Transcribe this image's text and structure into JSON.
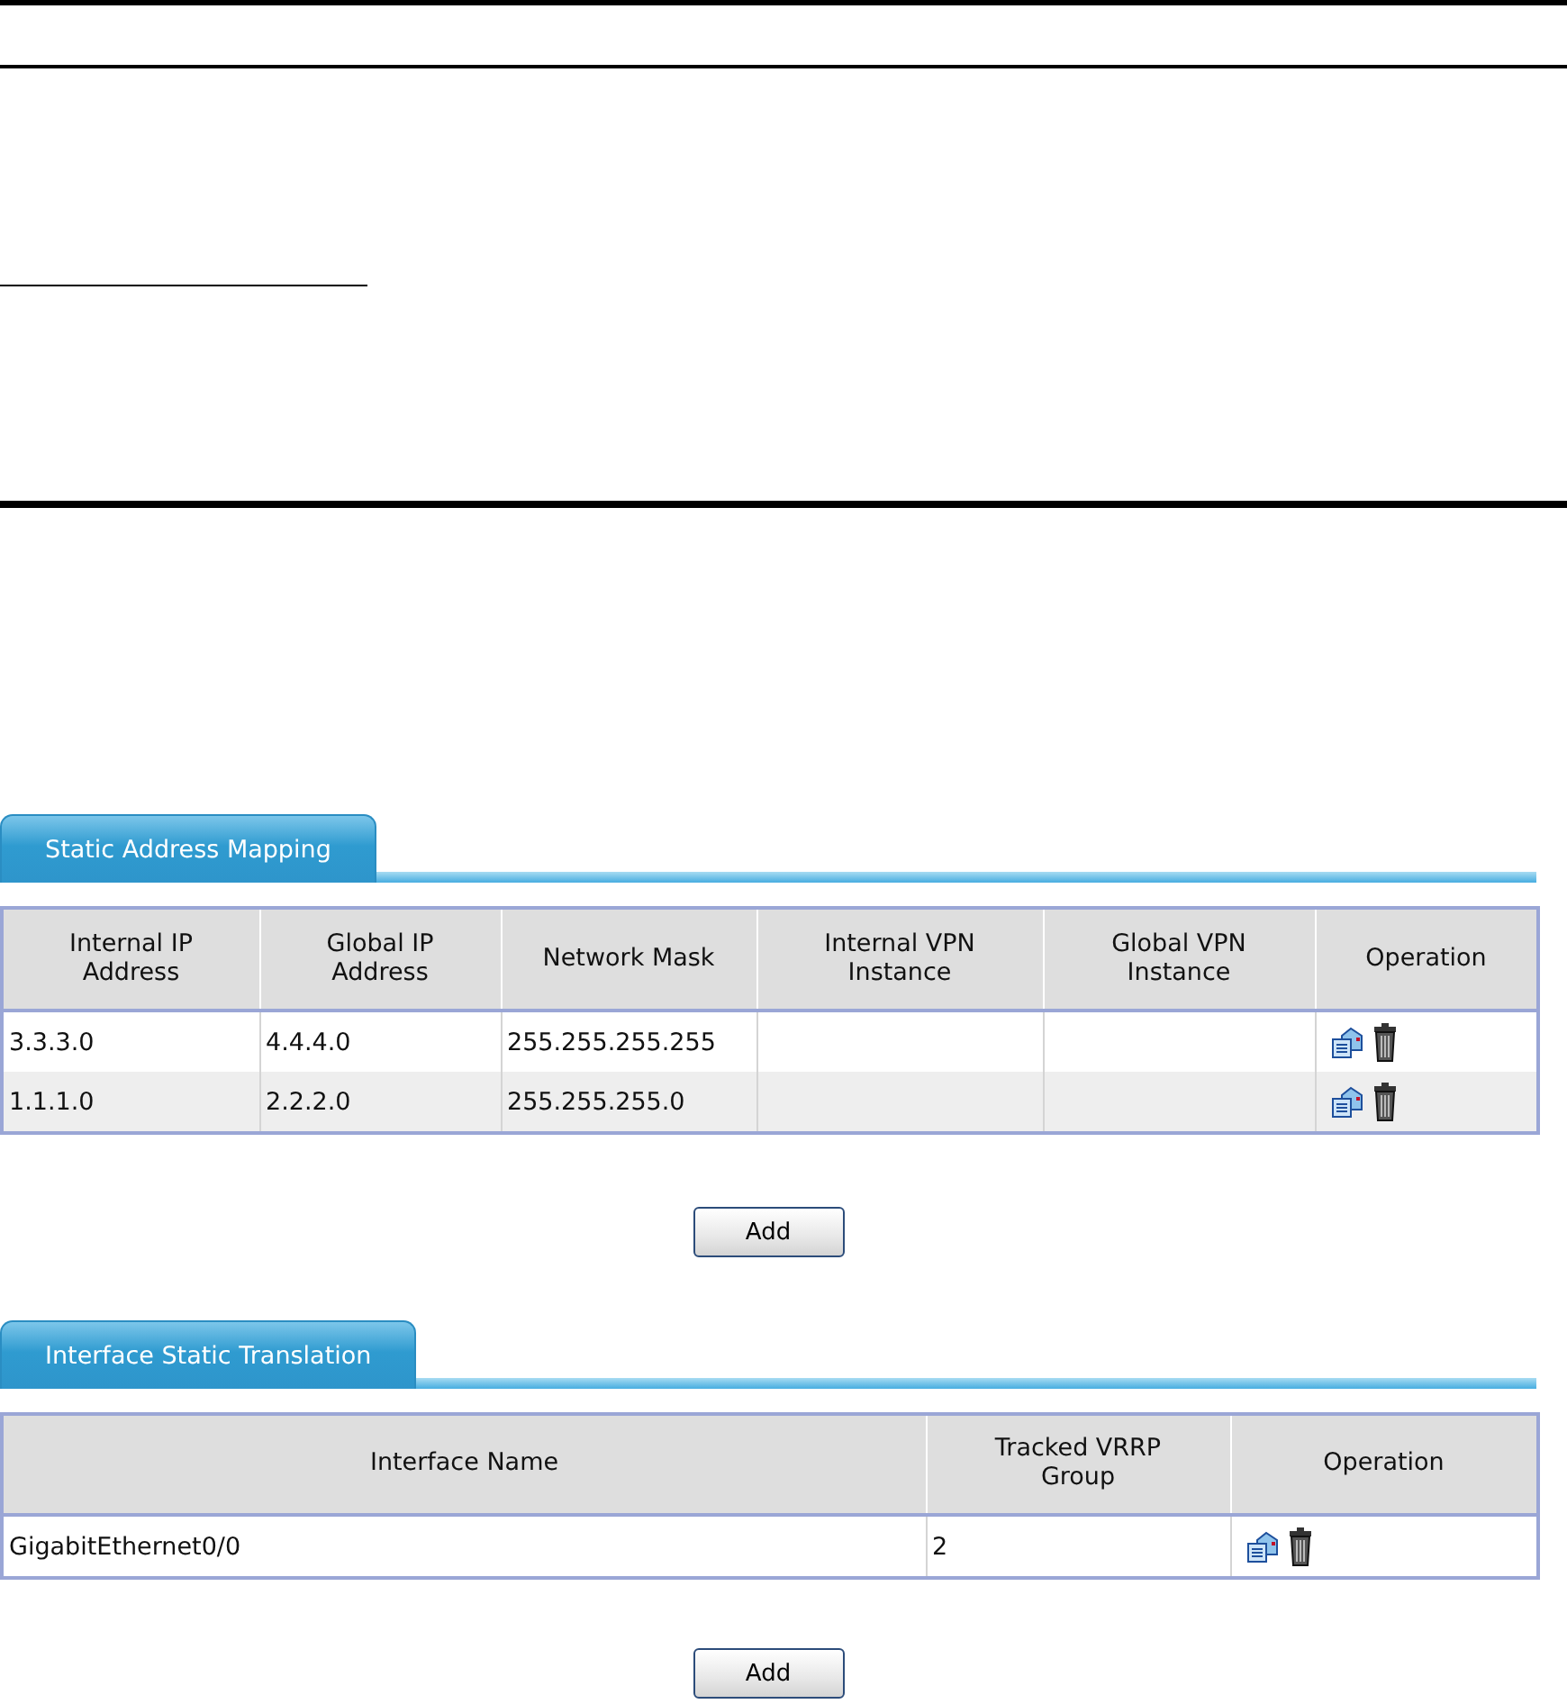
{
  "sections": [
    {
      "tab": "Static Address Mapping",
      "columns": [
        "Internal IP Address",
        "Global IP Address",
        "Network Mask",
        "Internal VPN Instance",
        "Global VPN Instance",
        "Operation"
      ],
      "rows": [
        [
          "3.3.3.0",
          "4.4.4.0",
          "255.255.255.255",
          "",
          ""
        ],
        [
          "1.1.1.0",
          "2.2.2.0",
          "255.255.255.0",
          "",
          ""
        ]
      ],
      "button": "Add"
    },
    {
      "tab": "Interface Static Translation",
      "columns": [
        "Interface Name",
        "Tracked VRRP Group",
        "Operation"
      ],
      "rows": [
        [
          "GigabitEthernet0/0",
          "2"
        ]
      ],
      "button": "Add"
    }
  ]
}
